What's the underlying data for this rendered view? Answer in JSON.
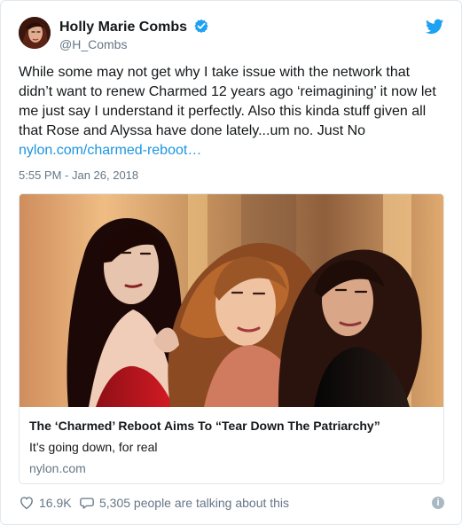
{
  "tweet": {
    "author": {
      "display_name": "Holly Marie Combs",
      "handle": "@H_Combs",
      "avatar_icon": "profile-photo",
      "verified_icon": "verified-badge-icon"
    },
    "brand_icon": "twitter-bird-icon",
    "text": "While some may not get why I take issue with the network that didn’t want to renew Charmed 12 years ago ‘reimagining’ it now let me just say I understand it perfectly. Also this kinda stuff given all that Rose and Alyssa have done lately...um no. Just No",
    "link_text": "nylon.com/charmed-reboot…",
    "timestamp": "5:55 PM - Jan 26, 2018"
  },
  "card": {
    "image_alt": "Three women posed together",
    "title": "The ‘Charmed’ Reboot Aims To “Tear Down The Patriarchy”",
    "description": "It’s going down, for real",
    "domain": "nylon.com"
  },
  "footer": {
    "likes": "16.9K",
    "conversation_text": "5,305 people are talking about this",
    "heart_icon": "heart-outline-icon",
    "comment_icon": "speech-bubble-icon",
    "info_icon": "info-icon"
  },
  "colors": {
    "link": "#1b95e0",
    "secondary_text": "#657786",
    "verified": "#1da1f2",
    "twitter_brand": "#1da1f2",
    "border": "#e1e8ed"
  }
}
